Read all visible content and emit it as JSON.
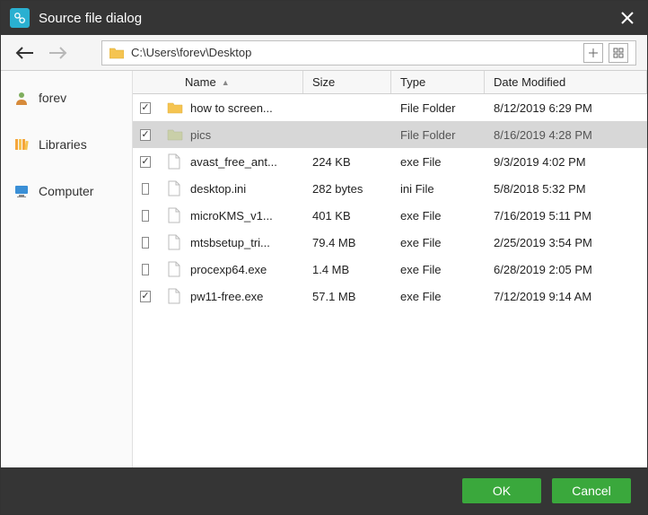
{
  "title": "Source file dialog",
  "path": "C:\\Users\\forev\\Desktop",
  "sidebar": [
    {
      "label": "forev",
      "icon": "user"
    },
    {
      "label": "Libraries",
      "icon": "libraries"
    },
    {
      "label": "Computer",
      "icon": "computer"
    }
  ],
  "columns": {
    "name": "Name",
    "size": "Size",
    "type": "Type",
    "date": "Date Modified"
  },
  "rows": [
    {
      "checked": true,
      "icon": "folder",
      "name": "how to screen...",
      "size": "",
      "type": "File Folder",
      "date": "8/12/2019 6:29 PM",
      "selected": false
    },
    {
      "checked": true,
      "icon": "folder-faded",
      "name": "pics",
      "size": "",
      "type": "File Folder",
      "date": "8/16/2019 4:28 PM",
      "selected": true
    },
    {
      "checked": true,
      "icon": "file",
      "name": "avast_free_ant...",
      "size": "224 KB",
      "type": "exe File",
      "date": "9/3/2019 4:02 PM",
      "selected": false
    },
    {
      "checked": false,
      "icon": "file",
      "name": "desktop.ini",
      "size": "282 bytes",
      "type": "ini File",
      "date": "5/8/2018 5:32 PM",
      "selected": false
    },
    {
      "checked": false,
      "icon": "file",
      "name": "microKMS_v1...",
      "size": "401 KB",
      "type": "exe File",
      "date": "7/16/2019 5:11 PM",
      "selected": false
    },
    {
      "checked": false,
      "icon": "file",
      "name": "mtsbsetup_tri...",
      "size": "79.4 MB",
      "type": "exe File",
      "date": "2/25/2019 3:54 PM",
      "selected": false
    },
    {
      "checked": false,
      "icon": "file",
      "name": "procexp64.exe",
      "size": "1.4 MB",
      "type": "exe File",
      "date": "6/28/2019 2:05 PM",
      "selected": false
    },
    {
      "checked": true,
      "icon": "file",
      "name": "pw11-free.exe",
      "size": "57.1 MB",
      "type": "exe File",
      "date": "7/12/2019 9:14 AM",
      "selected": false
    }
  ],
  "buttons": {
    "ok": "OK",
    "cancel": "Cancel"
  }
}
